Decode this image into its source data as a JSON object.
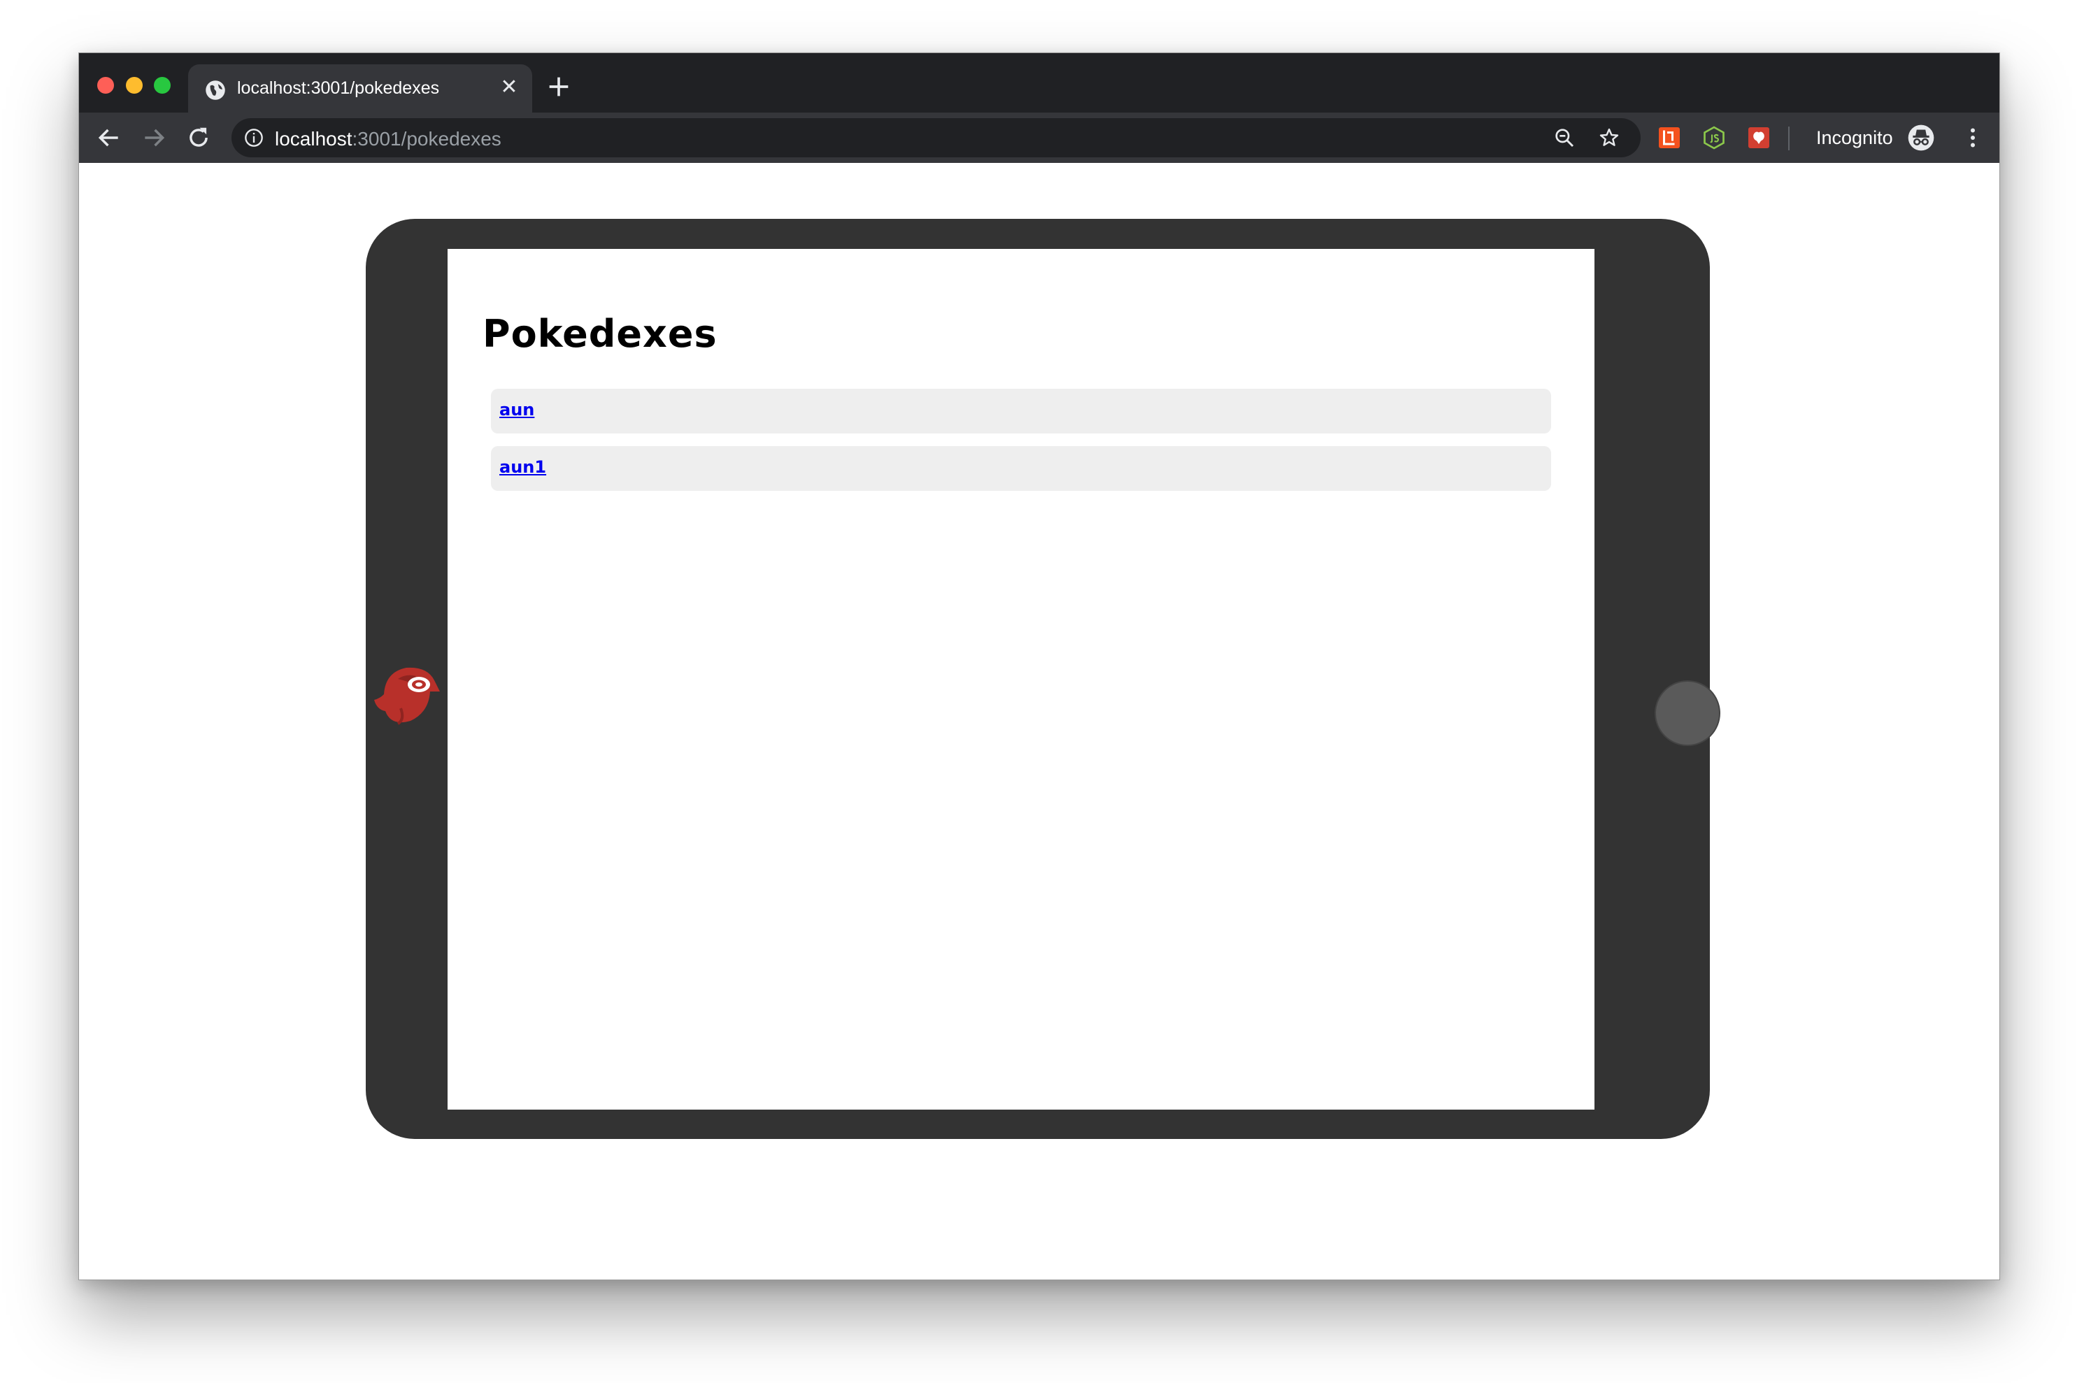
{
  "browser": {
    "tab": {
      "title": "localhost:3001/pokedexes",
      "close_glyph": "✕"
    },
    "new_tab_icon": "plus-icon",
    "url_host": "localhost",
    "url_rest": ":3001/pokedexes",
    "incognito_label": "Incognito",
    "extensions": [
      "lighthouse-extension-icon",
      "nodejs-extension-icon",
      "puzzle-extension-icon"
    ]
  },
  "page": {
    "title": "Pokedexes",
    "items": [
      {
        "label": "aun"
      },
      {
        "label": "aun1"
      }
    ]
  },
  "colors": {
    "tabstrip": "#202124",
    "toolbar": "#35363a",
    "tablet_bezel": "#333333",
    "list_item_bg": "#eeeeee",
    "link": "#0000ee",
    "home_button": "#5a5a5a"
  }
}
